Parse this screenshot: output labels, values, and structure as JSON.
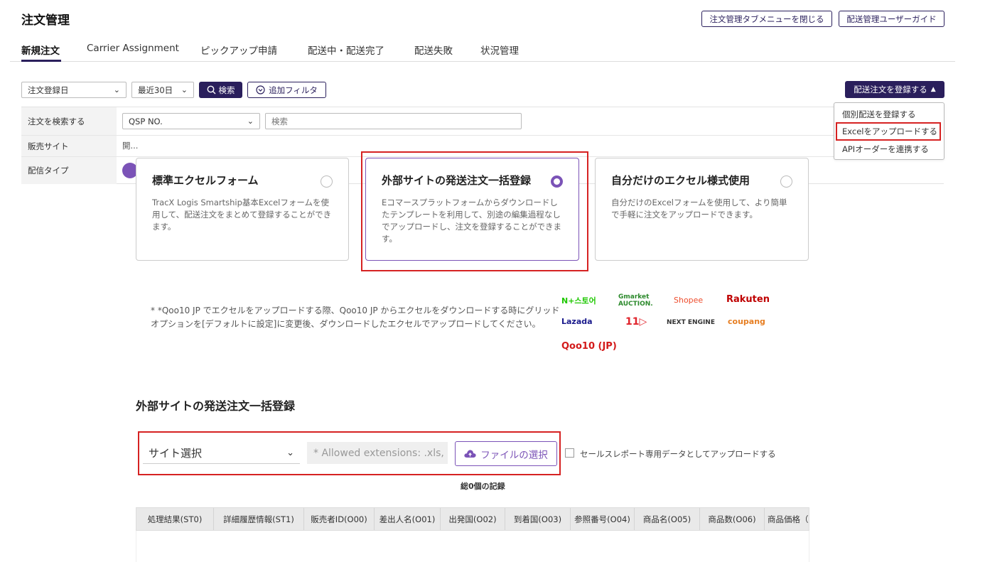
{
  "header": {
    "title": "注文管理",
    "close_tab_menu": "注文管理タブメニューを閉じる",
    "user_guide": "配送管理ユーザーガイド"
  },
  "tabs": [
    "新規注文",
    "Carrier Assignment",
    "ピックアップ申請",
    "配送中・配送完了",
    "配送失敗",
    "状況管理"
  ],
  "filter_bar": {
    "date_type": "注文登録日",
    "period": "最近30日",
    "search": "検索",
    "add_filter": "追加フィルタ",
    "register": "配送注文を登録する"
  },
  "register_menu": {
    "items": [
      "個別配送を登録する",
      "Excelをアップロードする",
      "APIオーダーを連携する"
    ],
    "highlighted": 1
  },
  "filters": {
    "search_label": "注文を検索する",
    "search_type": "QSP NO.",
    "search_placeholder": "検索",
    "site_label": "販売サイト",
    "site_value": "開...",
    "type_label": "配信タイプ"
  },
  "upload_cards": [
    {
      "title": "標準エクセルフォーム",
      "desc": "TracX Logis Smartship基本Excelフォームを使用して、配送注文をまとめて登録することができます。",
      "selected": false
    },
    {
      "title": "外部サイトの発送注文一括登録",
      "desc": "Eコマースプラットフォームからダウンロードしたテンプレートを利用して、別途の編集過程なしでアップロードし、注文を登録することができます。",
      "selected": true
    },
    {
      "title": "自分だけのエクセル様式使用",
      "desc": "自分だけのExcelフォームを使用して、より簡単で手軽に注文をアップロードできます。",
      "selected": false
    }
  ],
  "note": "* *Qoo10 JP でエクセルをアップロードする際、Qoo10 JP からエクセルをダウンロードする時にグリッドオプションを[デフォルトに設定]に変更後、ダウンロードしたエクセルでアップロードしてください。",
  "platform_logos": [
    "N+스토어",
    "Gmarket AUCTION.",
    "Shopee",
    "Rakuten",
    "Lazada",
    "11▷",
    "NEXT ENGINE",
    "coupang",
    "Qoo10 (JP)"
  ],
  "upload": {
    "section_title": "外部サイトの発送注文一括登録",
    "site_select": "サイト選択",
    "ext_placeholder": "* Allowed extensions: .xls,",
    "file_button": "ファイルの選択",
    "sales_report_label": "セールスレポート専用データとしてアップロードする",
    "total": "総0個の記録"
  },
  "grid": {
    "columns": [
      "処理結果(ST0)",
      "詳細履歴情報(ST1)",
      "販売者ID(O00)",
      "差出人名(O01)",
      "出発国(O02)",
      "到着国(O03)",
      "参照番号(O04)",
      "商品名(O05)",
      "商品数(O06)",
      "商品価格（"
    ]
  },
  "colors": {
    "primary": "#2a1f5c",
    "accent": "#7b53b7",
    "highlight": "#d62222"
  }
}
